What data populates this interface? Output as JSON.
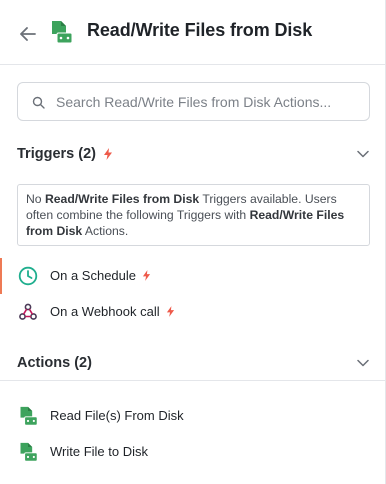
{
  "header": {
    "title": "Read/Write Files from Disk",
    "back_icon": "arrow-left-icon",
    "app_icon": "disk-file-icon",
    "brand_color": "#3da35d"
  },
  "search": {
    "placeholder": "Search Read/Write Files from Disk Actions...",
    "value": ""
  },
  "triggers": {
    "label": "Triggers (2)",
    "notice_parts": [
      "No ",
      "Read/Write Files from Disk",
      " Triggers available. Users often combine the following Triggers with ",
      "Read/Write Files from Disk",
      " Actions."
    ],
    "items": [
      {
        "label": "On a Schedule",
        "icon": "clock-icon",
        "active": true
      },
      {
        "label": "On a Webhook call",
        "icon": "webhook-icon",
        "active": false
      }
    ]
  },
  "actions": {
    "label": "Actions (2)",
    "items": [
      {
        "label": "Read File(s) From Disk",
        "icon": "disk-file-icon"
      },
      {
        "label": "Write File to Disk",
        "icon": "disk-file-icon"
      }
    ]
  },
  "colors": {
    "trigger_bolt": "#ee5a4a",
    "active_marker": "#ee7a55",
    "clock": "#1fae8e"
  }
}
